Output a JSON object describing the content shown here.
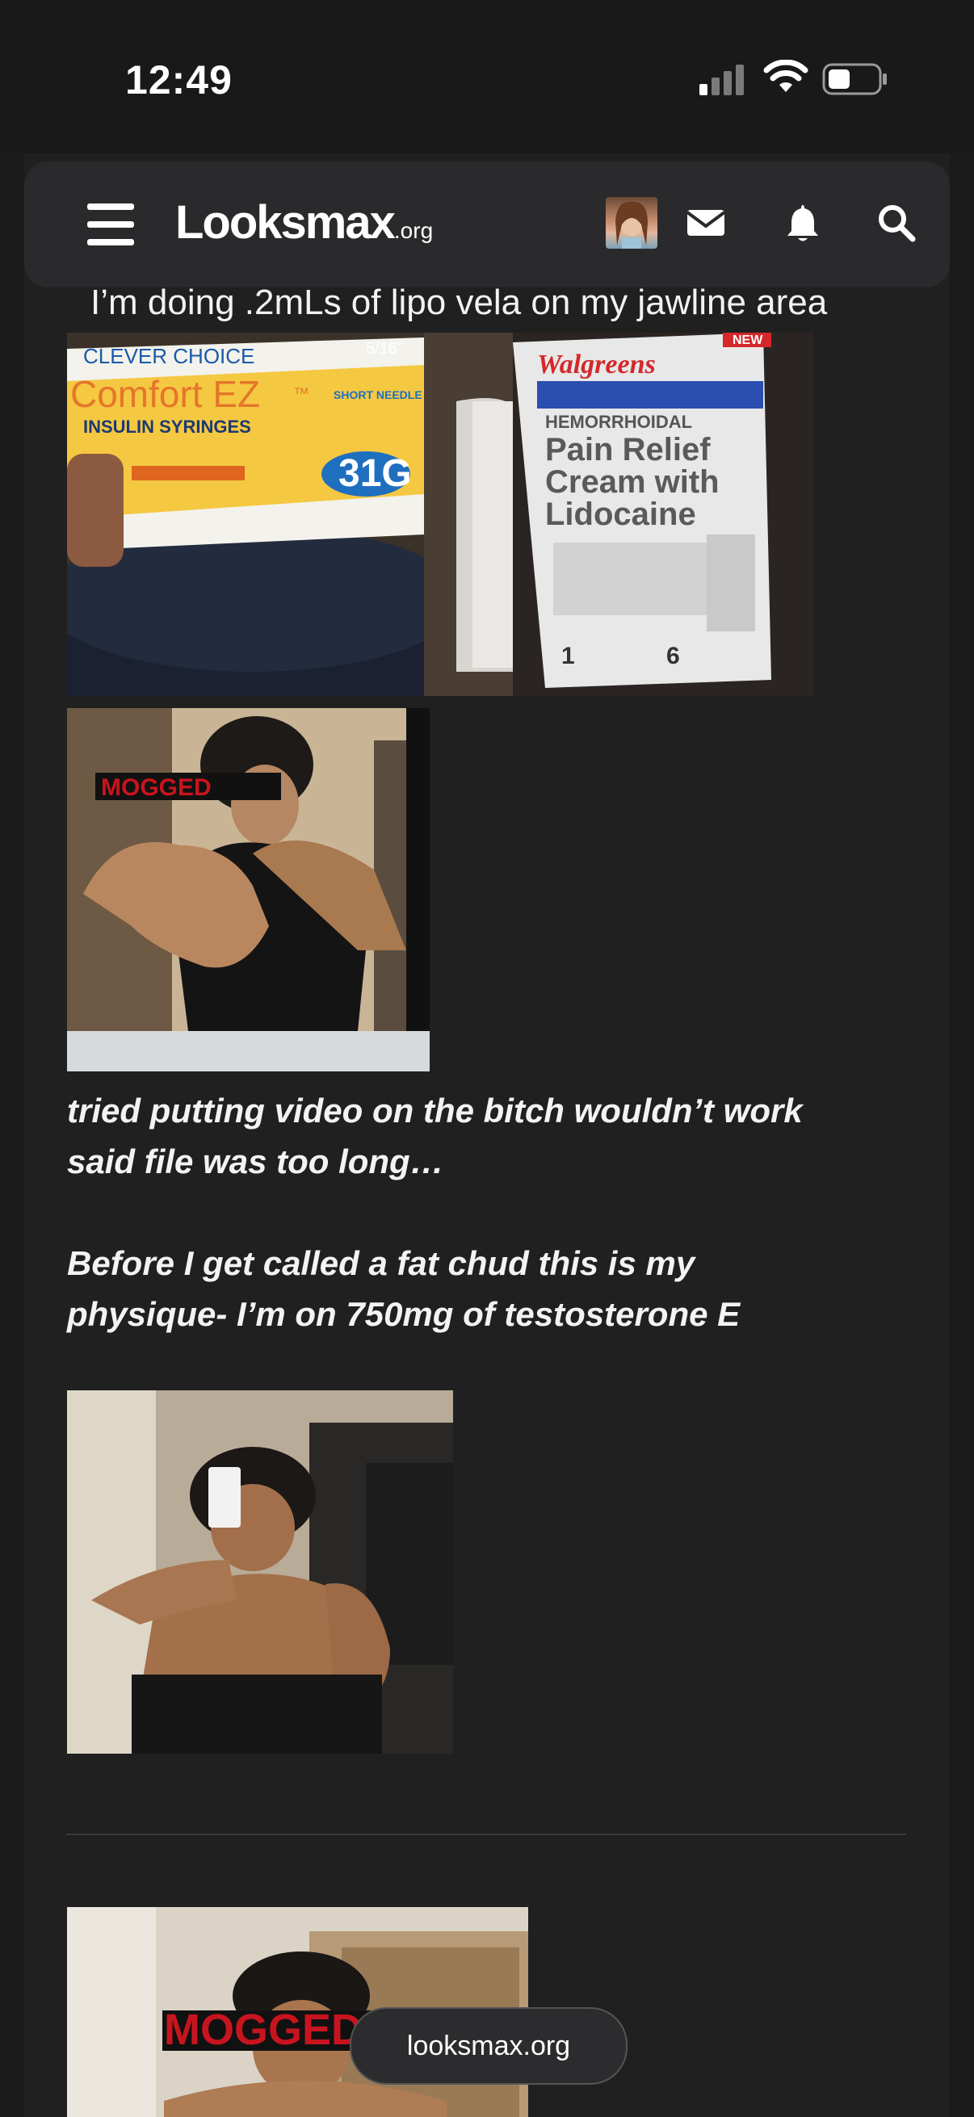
{
  "status_bar": {
    "time": "12:49"
  },
  "behind_text": "I’m doing .2mLs of lipo vela on my jawline area",
  "navbar": {
    "logo_main": "Looksmax",
    "logo_suffix": ".org",
    "icons": [
      "menu-icon",
      "avatar",
      "mail-icon",
      "bell-icon",
      "search-icon"
    ]
  },
  "post": {
    "images": [
      {
        "name": "syringes-photo",
        "brand": "CLEVER CHOICE",
        "product": "Comfort EZ",
        "tm": "™",
        "sub": "INSULIN SYRINGES",
        "gauge": "31G",
        "size": "5/16\"",
        "needle": "SHORT NEEDLE"
      },
      {
        "name": "cream-photo",
        "brand": "Walgreens",
        "category": "HEMORRHOIDAL",
        "product_line1": "Pain Relief",
        "product_line2": "Cream with",
        "product_line3": "Lidocaine",
        "new_badge": "NEW",
        "tube_count": "1",
        "packets": "6"
      },
      {
        "name": "mirror-selfie-1",
        "overlay": "MOGGED"
      },
      {
        "name": "mirror-selfie-2"
      },
      {
        "name": "mirror-selfie-3",
        "overlay": "MOGGED"
      }
    ],
    "caption_1_line1": "tried putting video on the bitch wouldn’t work",
    "caption_1_line2": "said file was too long…",
    "caption_2_line1": "Before I get called a fat chud this is my",
    "caption_2_line2": "physique- I’m on 750mg of testosterone E"
  },
  "browser": {
    "url": "looksmax.org"
  },
  "colors": {
    "background": "#1a1a1b",
    "navbar": "#2a2a2c",
    "text": "#f3f3f3",
    "mogged_red": "#c8141e"
  }
}
